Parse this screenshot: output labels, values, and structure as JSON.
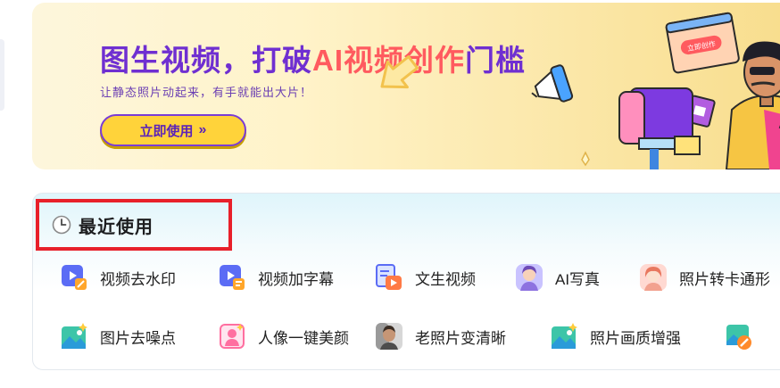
{
  "banner": {
    "title_part1": "图生视频，打破",
    "title_highlight": "AI视频创作",
    "title_part2": "门槛",
    "subtitle": "让静态照片动起来，有手就能出大片！",
    "cta_label": "立即使用",
    "cta_icon": "double-chevron-right-icon",
    "illustration_popup_label": "立即创作",
    "colors": {
      "title": "#6f2fd1",
      "highlight": "#ff5a5f",
      "cta_bg": "#ffd33a"
    }
  },
  "recent": {
    "title": "最近使用",
    "icon": "clock-icon",
    "row1": [
      {
        "label": "视频去水印",
        "icon": "video-watermark-remove-icon"
      },
      {
        "label": "视频加字幕",
        "icon": "video-subtitle-icon"
      },
      {
        "label": "文生视频",
        "icon": "text-to-video-icon"
      },
      {
        "label": "AI写真",
        "icon": "ai-portrait-icon"
      },
      {
        "label": "照片转卡通形",
        "icon": "photo-to-cartoon-icon"
      }
    ],
    "row2": [
      {
        "label": "图片去噪点",
        "icon": "image-denoise-icon"
      },
      {
        "label": "人像一键美颜",
        "icon": "portrait-beauty-icon"
      },
      {
        "label": "老照片变清晰",
        "icon": "old-photo-restore-icon"
      },
      {
        "label": "照片画质增强",
        "icon": "photo-enhance-icon"
      },
      {
        "label": "",
        "icon": "image-tool-icon"
      }
    ]
  }
}
